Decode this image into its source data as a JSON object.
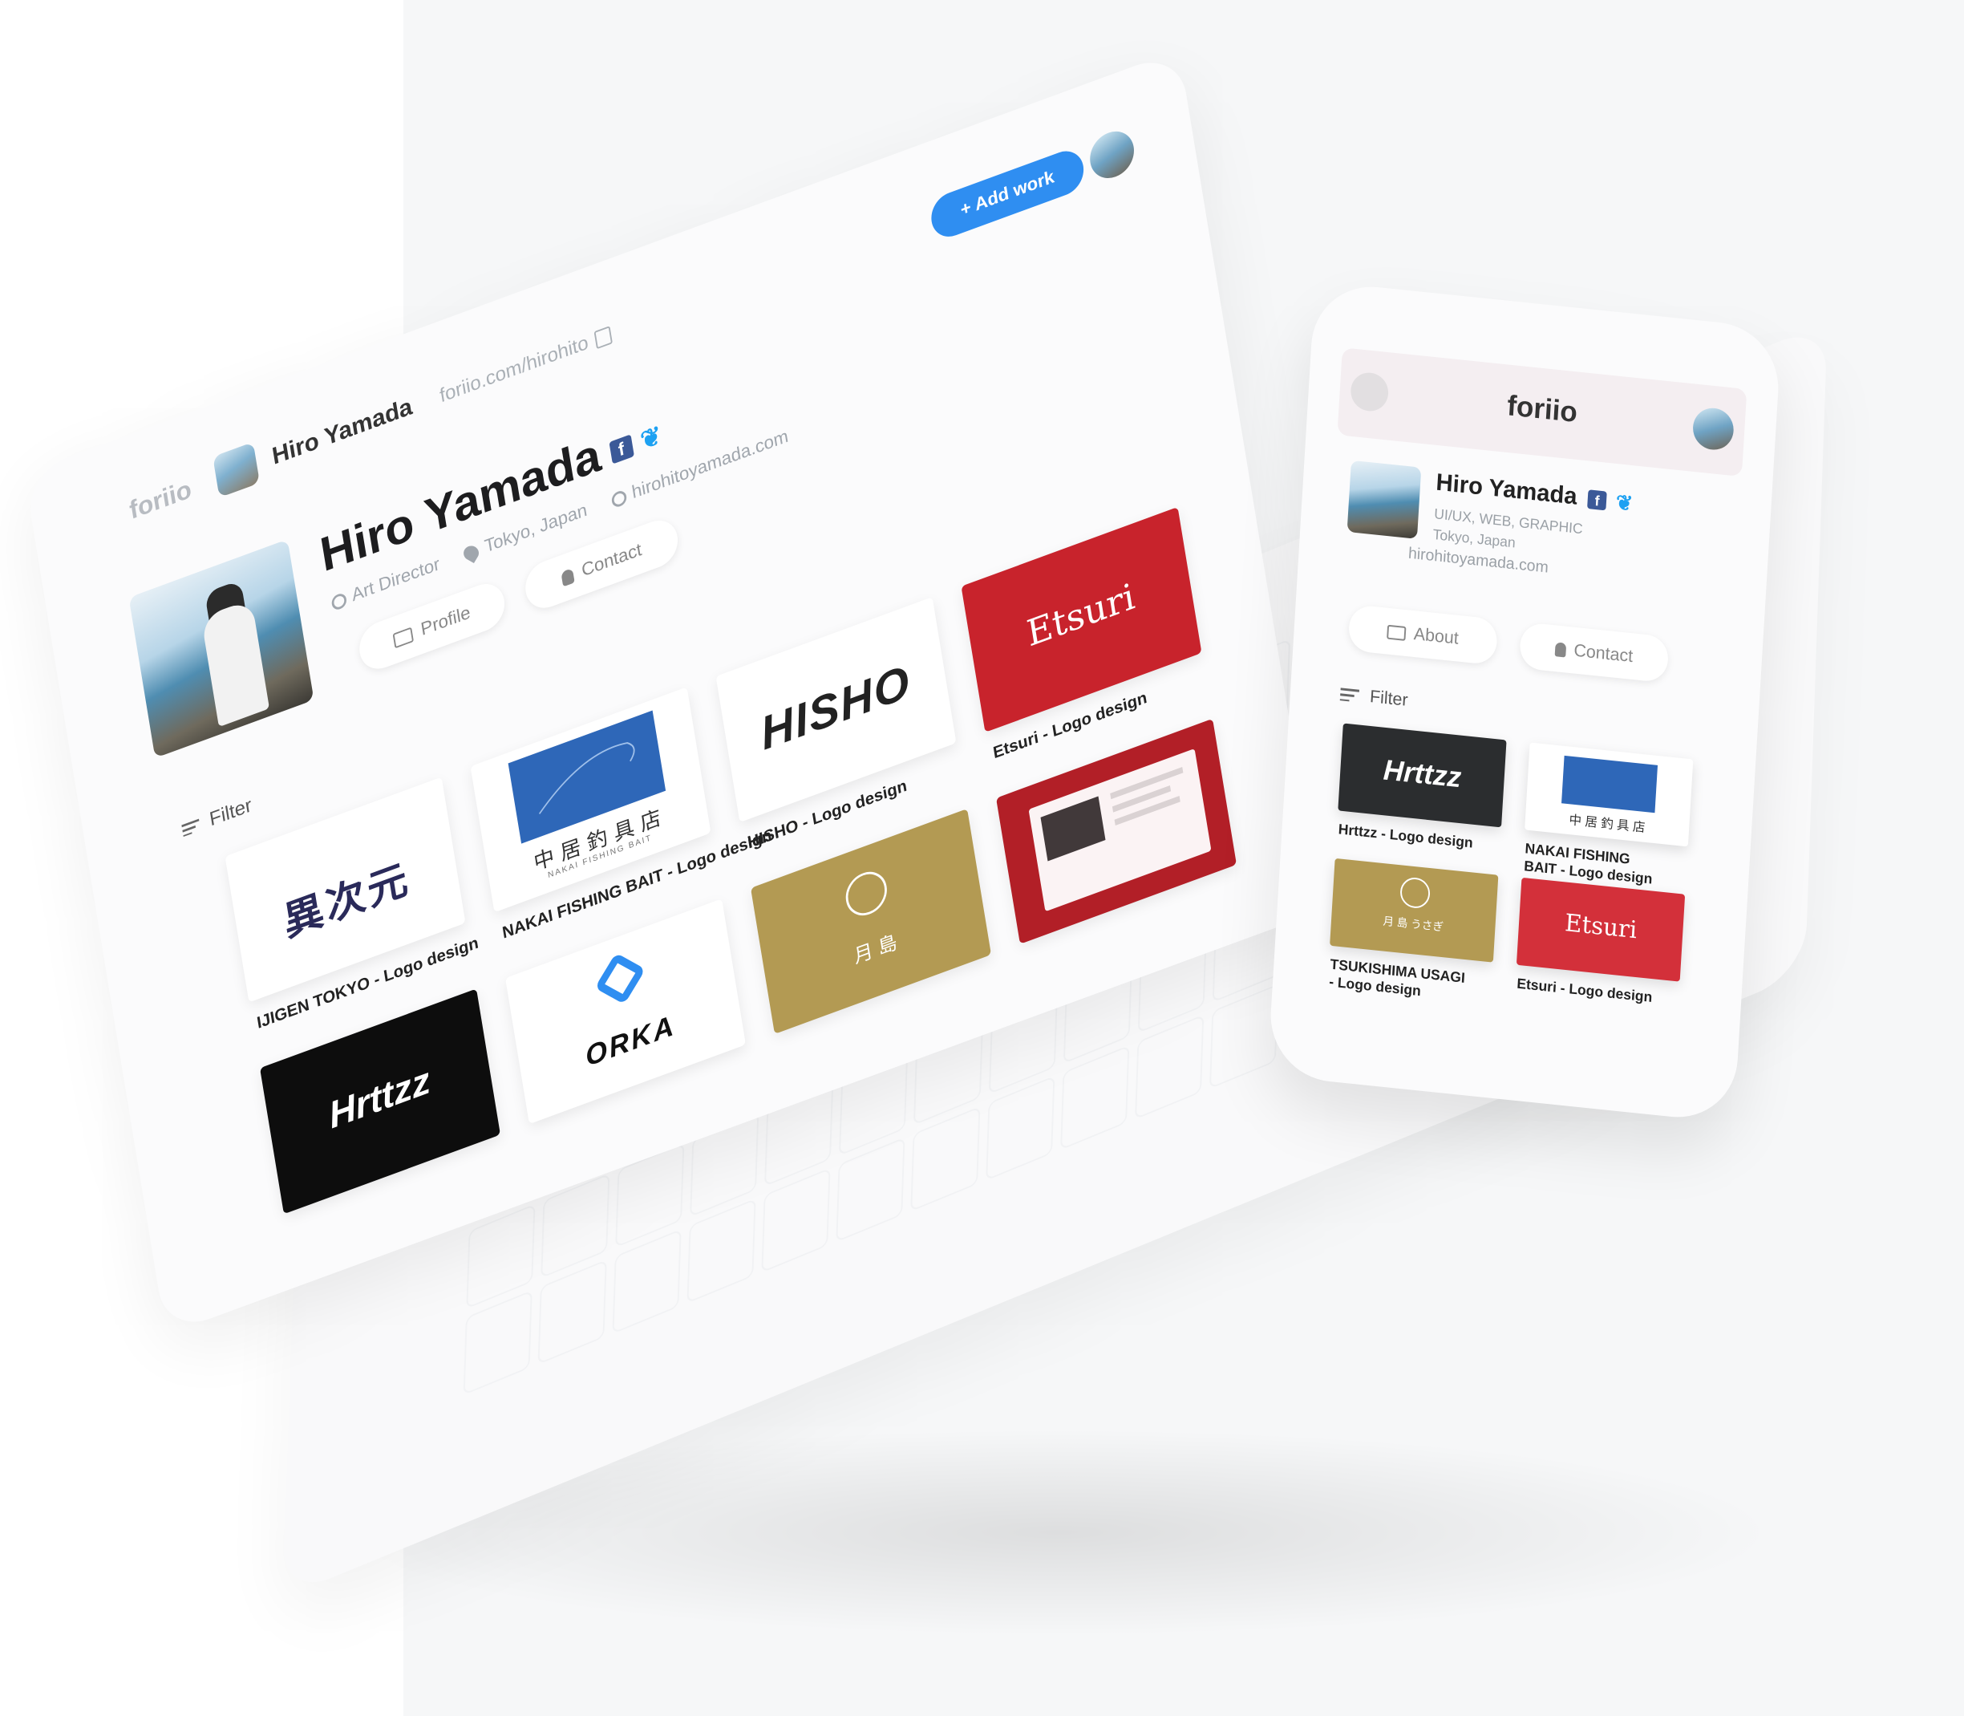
{
  "laptop": {
    "logo": "foriio",
    "header_name": "Hiro Yamada",
    "url": "foriio.com/hirohito",
    "add_work": "+ Add work",
    "profile": {
      "name": "Hiro Yamada",
      "role": "Art Director",
      "location": "Tokyo, Japan",
      "website": "hirohitoyamada.com",
      "profile_btn": "Profile",
      "contact_btn": "Contact"
    },
    "filter": "Filter",
    "works": [
      {
        "logo": "異次元",
        "caption": "IJIGEN TOKYO - Logo design"
      },
      {
        "logo": "中 居 釣 具 店",
        "sub": "NAKAI FISHING BAIT",
        "caption": "NAKAI FISHING BAIT - Logo design"
      },
      {
        "logo": "HISHO",
        "caption": "HISHO - Logo design"
      },
      {
        "logo": "Etsuri",
        "caption": "Etsuri - Logo design"
      },
      {
        "logo": "ORKA"
      },
      {
        "logo": "月 島"
      },
      {
        "logo": "Hrttzz"
      }
    ]
  },
  "phone": {
    "logo": "foriio",
    "name": "Hiro Yamada",
    "tags": "UI/UX, WEB, GRAPHIC",
    "location": "Tokyo, Japan",
    "website": "hirohitoyamada.com",
    "about_btn": "About",
    "contact_btn": "Contact",
    "filter": "Filter",
    "works": [
      {
        "logo": "Hrttzz",
        "caption": "Hrttzz - Logo design"
      },
      {
        "logo": "中 居 釣 具 店",
        "caption_1": "NAKAI FISHING",
        "caption_2": "BAIT - Logo design"
      },
      {
        "logo": "月 島 うさぎ",
        "caption_1": "TSUKISHIMA USAGI",
        "caption_2": "- Logo design"
      },
      {
        "logo": "Etsuri",
        "caption": "Etsuri - Logo design"
      }
    ]
  },
  "colors": {
    "accent": "#2f8ef1",
    "etsuri_red": "#c8232c",
    "nakai_blue": "#2e67b8",
    "gold": "#b39a53",
    "facebook": "#3b5998",
    "twitter": "#1da1f2"
  }
}
